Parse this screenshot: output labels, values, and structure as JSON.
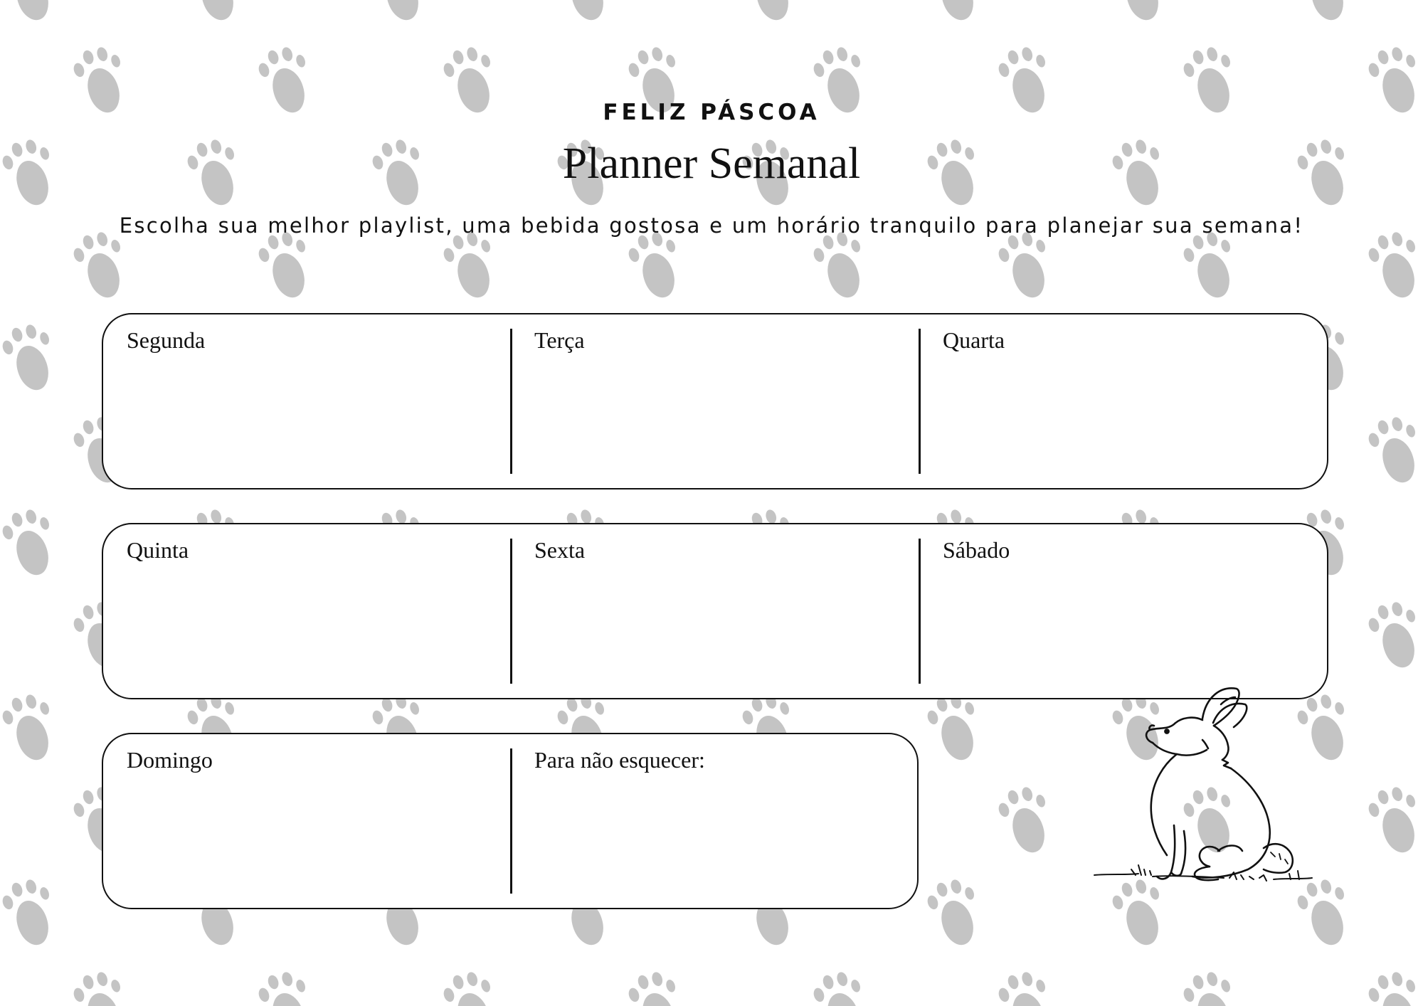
{
  "header": {
    "eyebrow": "FELIZ PÁSCOA",
    "title": "Planner Semanal",
    "subtitle": "Escolha sua melhor playlist, uma bebida gostosa e um horário tranquilo para planejar sua semana!"
  },
  "rows": [
    {
      "cells": [
        "Segunda",
        "Terça",
        "Quarta"
      ]
    },
    {
      "cells": [
        "Quinta",
        "Sexta",
        "Sábado"
      ]
    },
    {
      "cells": [
        "Domingo",
        "Para não esquecer:"
      ]
    }
  ],
  "decorations": {
    "background_pattern": "bunny-paw-icon",
    "illustration": "bunny-illustration",
    "paw_color": "#c4c4c4",
    "line_color": "#111111"
  }
}
